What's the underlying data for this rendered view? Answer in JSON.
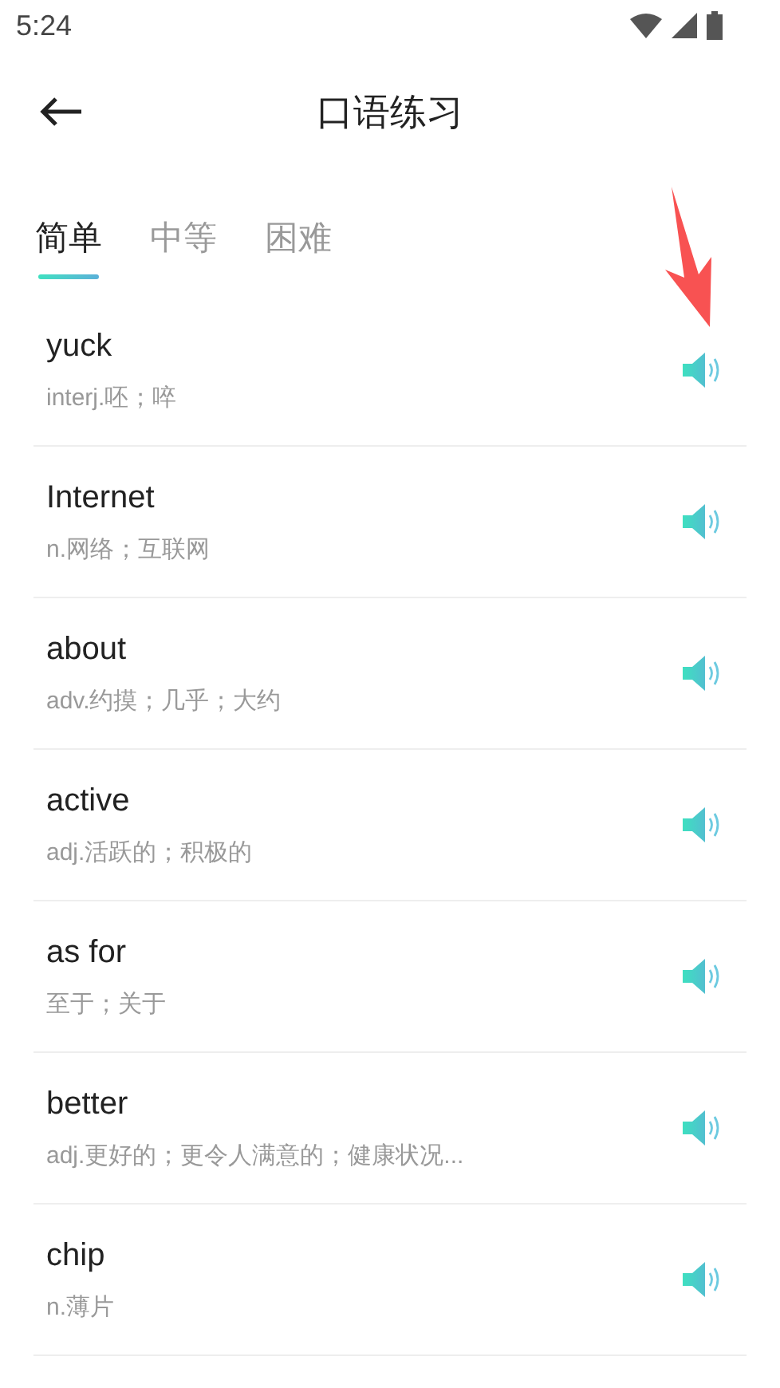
{
  "status_bar": {
    "time": "5:24"
  },
  "header": {
    "title": "口语练习"
  },
  "tabs": [
    {
      "label": "简单",
      "selected": true
    },
    {
      "label": "中等",
      "selected": false
    },
    {
      "label": "困难",
      "selected": false
    }
  ],
  "words": [
    {
      "word": "yuck",
      "meaning": "interj.呸；啐"
    },
    {
      "word": "Internet",
      "meaning": "n.网络；互联网"
    },
    {
      "word": "about",
      "meaning": "adv.约摸；几乎；大约"
    },
    {
      "word": "active",
      "meaning": "adj.活跃的；积极的"
    },
    {
      "word": "as for",
      "meaning": "至于；关于"
    },
    {
      "word": "better",
      "meaning": "adj.更好的；更令人满意的；健康状况..."
    },
    {
      "word": "chip",
      "meaning": "n.薄片"
    }
  ]
}
